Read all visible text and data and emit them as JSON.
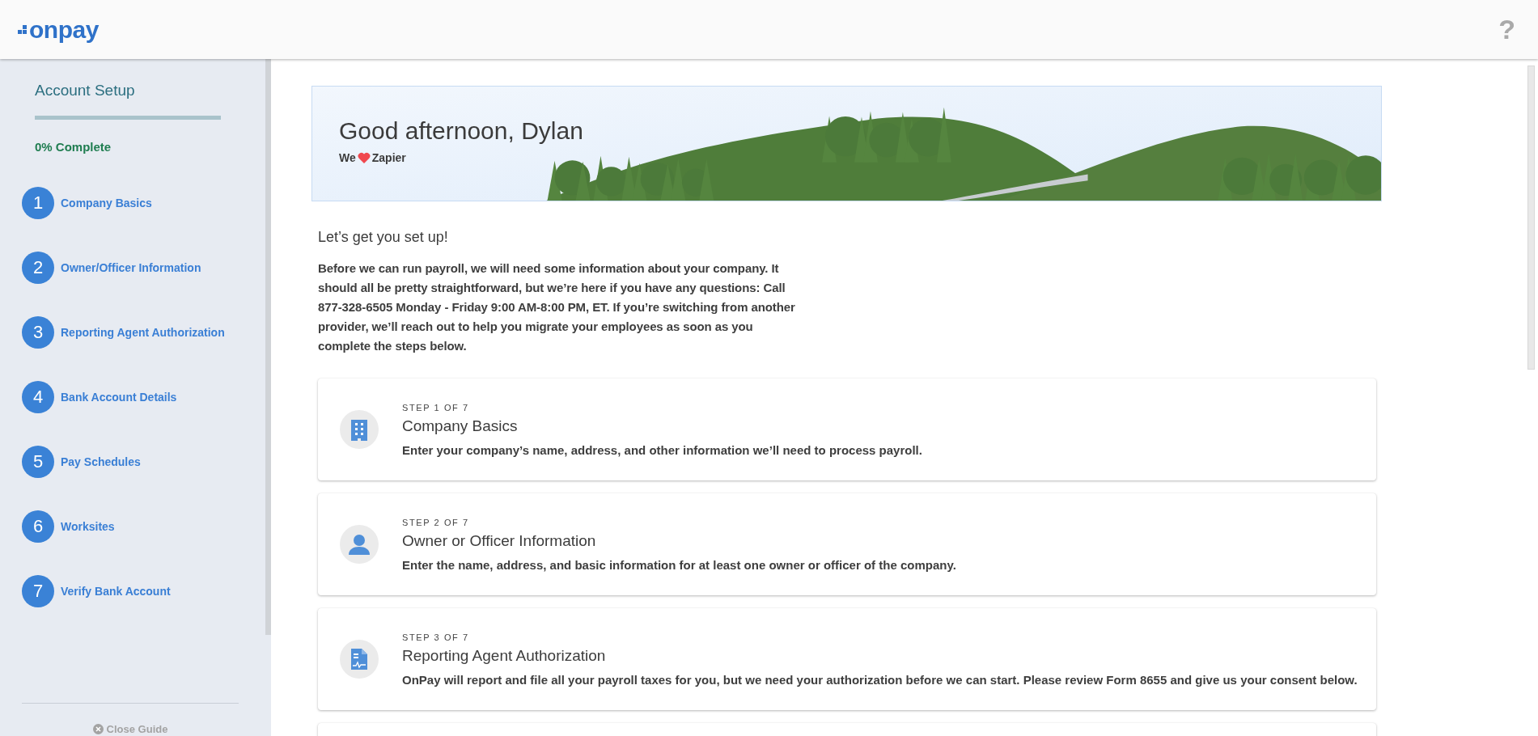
{
  "header": {
    "logo": "onpay",
    "help": "?"
  },
  "sidebar": {
    "title": "Account Setup",
    "progress": {
      "level": 0
    },
    "complete": "0% Complete",
    "items": [
      {
        "number": "1",
        "label": "Company Basics"
      },
      {
        "number": "2",
        "label": "Owner/Officer Information"
      },
      {
        "number": "3",
        "label": "Reporting Agent Authorization"
      },
      {
        "number": "4",
        "label": "Bank Account Details"
      },
      {
        "number": "5",
        "label": "Pay Schedules"
      },
      {
        "number": "6",
        "label": "Worksites"
      },
      {
        "number": "7",
        "label": "Verify Bank Account"
      }
    ],
    "close": "Close Guide"
  },
  "banner": {
    "greeting": "Good afternoon, Dylan",
    "love_before": "We",
    "love_after": "Zapier"
  },
  "intro": {
    "heading": "Let’s get you set up!",
    "body": "Before we can run payroll, we will need some information about your company. It should all be pretty straightforward, but we’re here if you have any questions: Call 877-328-6505 Monday - Friday 9:00 AM-8:00 PM, ET. If you’re switching from another provider, we’ll reach out to help you migrate your employees as soon as you complete the steps below."
  },
  "steps": [
    {
      "kind": "building",
      "step": "STEP 1 OF 7",
      "title": "Company Basics",
      "description": "Enter your company’s name, address, and other information we’ll need to process payroll."
    },
    {
      "kind": "person",
      "step": "STEP 2 OF 7",
      "title": "Owner or Officer Information",
      "description": "Enter the name, address, and basic information for at least one owner or officer of the company."
    },
    {
      "kind": "document",
      "step": "STEP 3 OF 7",
      "title": "Reporting Agent Authorization",
      "description": "OnPay will report and file all your payroll taxes for you, but we need your authorization before we can start. Please review Form 8655 and give us your consent below."
    },
    {
      "kind": "empty"
    }
  ]
}
